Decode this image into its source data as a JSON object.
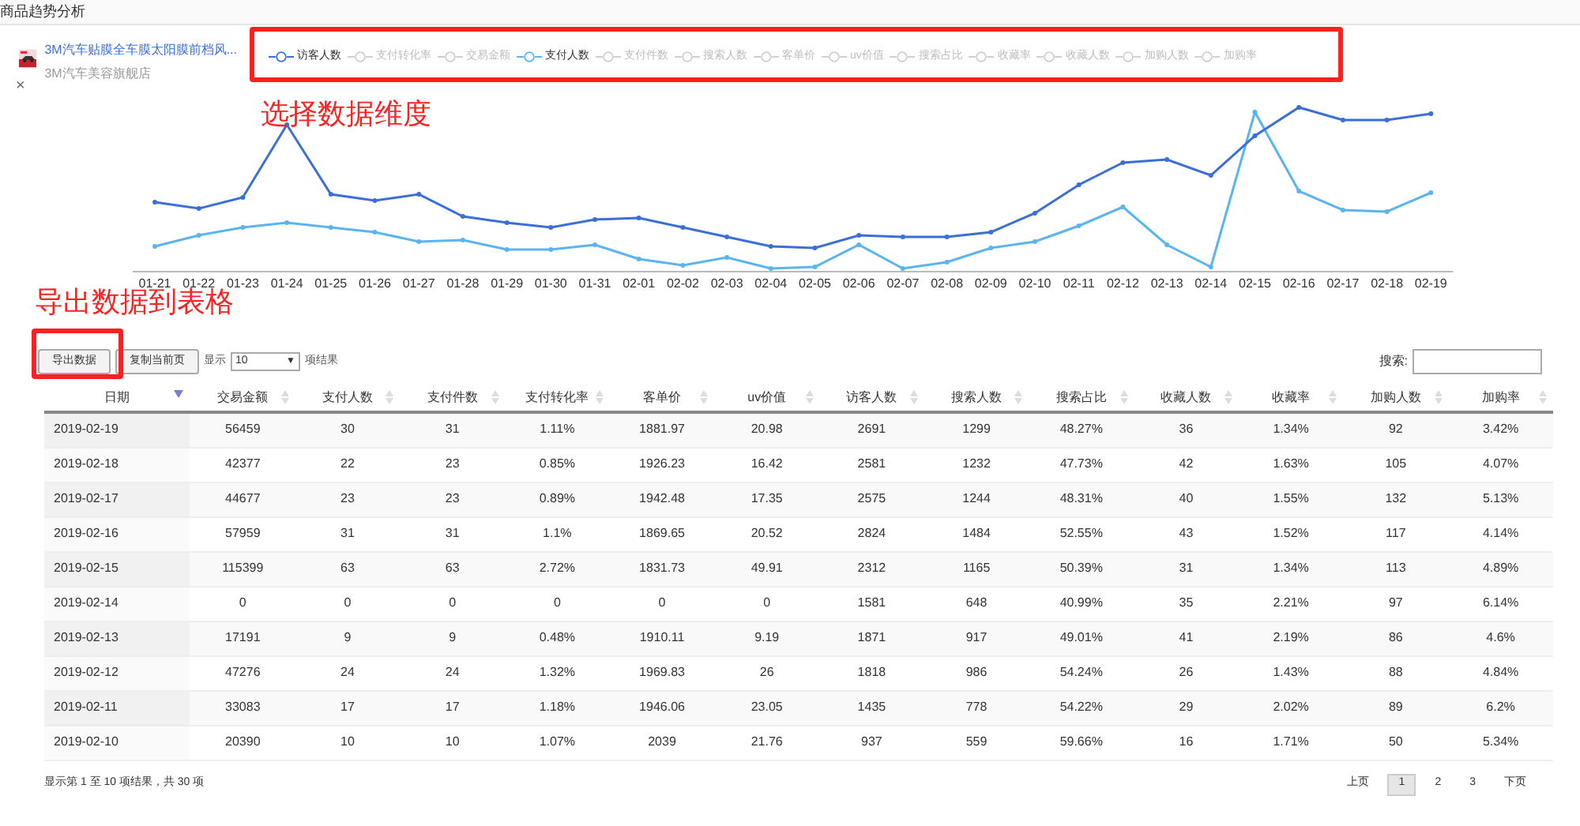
{
  "page_title": "商品趋势分析",
  "product": {
    "name": "3M汽车贴膜全车膜太阳膜前档风...",
    "shop": "3M汽车美容旗舰店",
    "close": "×"
  },
  "legend": [
    {
      "label": "访客人数",
      "selected": true,
      "color": "#3b6fd8"
    },
    {
      "label": "支付转化率",
      "selected": false
    },
    {
      "label": "交易金额",
      "selected": false
    },
    {
      "label": "支付人数",
      "selected": true,
      "color": "#5ab4f0"
    },
    {
      "label": "支付件数",
      "selected": false
    },
    {
      "label": "搜索人数",
      "selected": false
    },
    {
      "label": "客单价",
      "selected": false
    },
    {
      "label": "uv价值",
      "selected": false
    },
    {
      "label": "搜索占比",
      "selected": false
    },
    {
      "label": "收藏率",
      "selected": false
    },
    {
      "label": "收藏人数",
      "selected": false
    },
    {
      "label": "加购人数",
      "selected": false
    },
    {
      "label": "加购率",
      "selected": false
    }
  ],
  "chart": {
    "x_labels": [
      "01-21",
      "01-22",
      "01-23",
      "01-24",
      "01-25",
      "01-26",
      "01-27",
      "01-28",
      "01-29",
      "01-30",
      "01-31",
      "02-01",
      "02-02",
      "02-03",
      "02-04",
      "02-05",
      "02-06",
      "02-07",
      "02-08",
      "02-09",
      "02-10",
      "02-11",
      "02-12",
      "02-13",
      "02-14",
      "02-15",
      "02-16",
      "02-17",
      "02-18",
      "02-19"
    ]
  },
  "annotations": [
    {
      "kind": "text",
      "text": "选择数据维度"
    },
    {
      "kind": "text",
      "text": "导出数据到表格"
    },
    {
      "kind": "box"
    },
    {
      "kind": "box"
    }
  ],
  "toolbar": {
    "export_button": "导出数据",
    "copy_button": "复制当前页",
    "show_label": "显示",
    "page_size": "10",
    "page_size_caret": "▼",
    "results_label": "项结果",
    "search_label": "搜索:"
  },
  "table": {
    "columns": [
      {
        "label": "日期",
        "sorted": true
      },
      {
        "label": "交易金额",
        "sorted": false
      },
      {
        "label": "支付人数",
        "sorted": false
      },
      {
        "label": "支付件数",
        "sorted": false
      },
      {
        "label": "支付转化率",
        "sorted": false
      },
      {
        "label": "客单价",
        "sorted": false
      },
      {
        "label": "uv价值",
        "sorted": false
      },
      {
        "label": "访客人数",
        "sorted": false
      },
      {
        "label": "搜索人数",
        "sorted": false
      },
      {
        "label": "搜索占比",
        "sorted": false
      },
      {
        "label": "收藏人数",
        "sorted": false
      },
      {
        "label": "收藏率",
        "sorted": false
      },
      {
        "label": "加购人数",
        "sorted": false
      },
      {
        "label": "加购率",
        "sorted": false
      }
    ],
    "rows": [
      [
        "2019-02-19",
        "56459",
        "30",
        "31",
        "1.11%",
        "1881.97",
        "20.98",
        "2691",
        "1299",
        "48.27%",
        "36",
        "1.34%",
        "92",
        "3.42%"
      ],
      [
        "2019-02-18",
        "42377",
        "22",
        "23",
        "0.85%",
        "1926.23",
        "16.42",
        "2581",
        "1232",
        "47.73%",
        "42",
        "1.63%",
        "105",
        "4.07%"
      ],
      [
        "2019-02-17",
        "44677",
        "23",
        "23",
        "0.89%",
        "1942.48",
        "17.35",
        "2575",
        "1244",
        "48.31%",
        "40",
        "1.55%",
        "132",
        "5.13%"
      ],
      [
        "2019-02-16",
        "57959",
        "31",
        "31",
        "1.1%",
        "1869.65",
        "20.52",
        "2824",
        "1484",
        "52.55%",
        "43",
        "1.52%",
        "117",
        "4.14%"
      ],
      [
        "2019-02-15",
        "115399",
        "63",
        "63",
        "2.72%",
        "1831.73",
        "49.91",
        "2312",
        "1165",
        "50.39%",
        "31",
        "1.34%",
        "113",
        "4.89%"
      ],
      [
        "2019-02-14",
        "0",
        "0",
        "0",
        "0",
        "0",
        "0",
        "1581",
        "648",
        "40.99%",
        "35",
        "2.21%",
        "97",
        "6.14%"
      ],
      [
        "2019-02-13",
        "17191",
        "9",
        "9",
        "0.48%",
        "1910.11",
        "9.19",
        "1871",
        "917",
        "49.01%",
        "41",
        "2.19%",
        "86",
        "4.6%"
      ],
      [
        "2019-02-12",
        "47276",
        "24",
        "24",
        "1.32%",
        "1969.83",
        "26",
        "1818",
        "986",
        "54.24%",
        "26",
        "1.43%",
        "88",
        "4.84%"
      ],
      [
        "2019-02-11",
        "33083",
        "17",
        "17",
        "1.18%",
        "1946.06",
        "23.05",
        "1435",
        "778",
        "54.22%",
        "29",
        "2.02%",
        "89",
        "6.2%"
      ],
      [
        "2019-02-10",
        "20390",
        "10",
        "10",
        "1.07%",
        "2039",
        "21.76",
        "937",
        "559",
        "59.66%",
        "16",
        "1.71%",
        "50",
        "5.34%"
      ]
    ]
  },
  "footer": {
    "info": "显示第 1 至 10 项结果，共 30 项",
    "pages": [
      {
        "label": "上页",
        "selected": false
      },
      {
        "label": "1",
        "selected": true
      },
      {
        "label": "2",
        "selected": false
      },
      {
        "label": "3",
        "selected": false
      },
      {
        "label": "下页",
        "selected": false
      }
    ]
  }
}
